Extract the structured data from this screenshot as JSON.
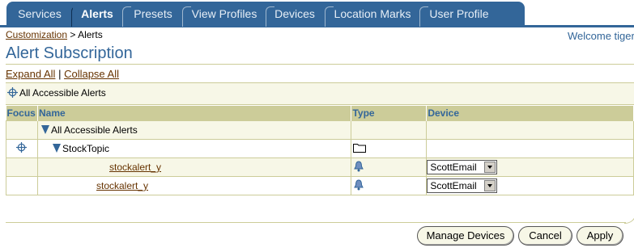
{
  "tabs": [
    {
      "label": "Services"
    },
    {
      "label": "Alerts"
    },
    {
      "label": "Presets"
    },
    {
      "label": "View Profiles"
    },
    {
      "label": "Devices"
    },
    {
      "label": "Location Marks"
    },
    {
      "label": "User Profile"
    }
  ],
  "breadcrumb": {
    "link": "Customization",
    "separator": ">",
    "current": "Alerts"
  },
  "welcome": "Welcome tiger",
  "page_title": "Alert Subscription",
  "expand_all": "Expand All",
  "links_separator": "|",
  "collapse_all": "Collapse All",
  "focus_path": "All Accessible Alerts",
  "table": {
    "headers": {
      "focus": "Focus",
      "name": "Name",
      "type": "Type",
      "device": "Device"
    },
    "rows": [
      {
        "name": "All Accessible Alerts"
      },
      {
        "name": "StockTopic"
      },
      {
        "name": "stockalert_y",
        "device": "ScottEmail"
      },
      {
        "name": "stockalert_y",
        "device": "ScottEmail"
      }
    ]
  },
  "icons": {
    "focus": "crosshair-icon",
    "expand": "triangle-down-icon",
    "folder": "folder-icon",
    "alert": "bell-icon"
  },
  "buttons": {
    "manage_devices": "Manage Devices",
    "cancel": "Cancel",
    "apply": "Apply"
  },
  "colors": {
    "brand": "#336699",
    "header_bg": "#cccc99",
    "row_shade": "#f7f7e7",
    "link": "#663300"
  }
}
